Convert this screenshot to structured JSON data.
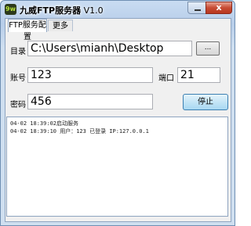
{
  "window": {
    "title_name": "九威FTP服务器",
    "title_version": "V1.0",
    "app_icon_text": "9w",
    "minimize_label": "",
    "close_label": "x"
  },
  "tabs": [
    {
      "label": "FTP服务配置",
      "active": true
    },
    {
      "label": "更多",
      "active": false
    }
  ],
  "form": {
    "directory_label": "目录",
    "directory_value": "C:\\Users\\mianh\\Desktop",
    "browse_label": "...",
    "account_label": "账号",
    "account_value": "123",
    "port_label": "端口",
    "port_value": "21",
    "password_label": "密码",
    "password_value": "456",
    "stop_label": "停止"
  },
  "log": {
    "lines": [
      "04-02 18:39:02启动服务",
      "04-02 18:39:10 用户：123 已登录 IP:127.0.0.1"
    ]
  }
}
